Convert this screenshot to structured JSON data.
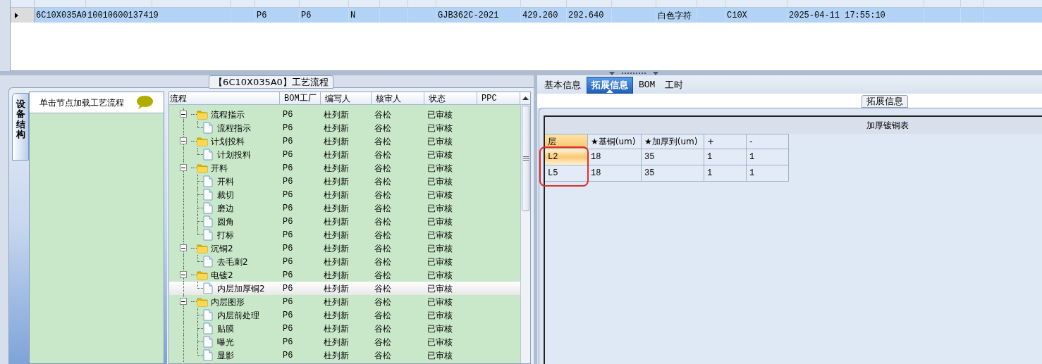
{
  "top_grid": {
    "rows": [
      {
        "selected": true,
        "column_1": "6C10X035A0",
        "column_2": "10010600137419",
        "column_5": "P6",
        "column_6": "P6",
        "column_7": "N",
        "column_10": "GJB362C-2021",
        "column_11": "429.260",
        "column_12": "292.640",
        "column_14": "白色字符",
        "column_16": "C10X",
        "column_17": "2025-04-11 17:55:10"
      }
    ]
  },
  "process_panel": {
    "title": "【6C10X035A0】工艺流程",
    "side_tab": "设备结构",
    "hint": "单击节点加载工艺流程",
    "tree": {
      "columns": [
        "流程",
        "BOM工厂",
        "编写人",
        "核审人",
        "状态",
        "PPC"
      ],
      "nodes": [
        {
          "label": "流程指示",
          "bom": "P6",
          "writer": "杜列新",
          "reviewer": "谷松",
          "status": "已审核",
          "expanded": true,
          "selected": false,
          "children": [
            {
              "label": "流程指示",
              "bom": "P6",
              "writer": "杜列新",
              "reviewer": "谷松",
              "status": "已审核",
              "selected": false
            }
          ]
        },
        {
          "label": "计划投料",
          "bom": "P6",
          "writer": "杜列新",
          "reviewer": "谷松",
          "status": "已审核",
          "expanded": true,
          "selected": false,
          "children": [
            {
              "label": "计划投料",
              "bom": "P6",
              "writer": "杜列新",
              "reviewer": "谷松",
              "status": "已审核",
              "selected": false
            }
          ]
        },
        {
          "label": "开料",
          "bom": "P6",
          "writer": "杜列新",
          "reviewer": "谷松",
          "status": "已审核",
          "expanded": true,
          "selected": false,
          "children": [
            {
              "label": "开料",
              "bom": "P6",
              "writer": "杜列新",
              "reviewer": "谷松",
              "status": "已审核",
              "selected": false
            },
            {
              "label": "裁切",
              "bom": "P6",
              "writer": "杜列新",
              "reviewer": "谷松",
              "status": "已审核",
              "selected": false
            },
            {
              "label": "磨边",
              "bom": "P6",
              "writer": "杜列新",
              "reviewer": "谷松",
              "status": "已审核",
              "selected": false
            },
            {
              "label": "圆角",
              "bom": "P6",
              "writer": "杜列新",
              "reviewer": "谷松",
              "status": "已审核",
              "selected": false
            },
            {
              "label": "打标",
              "bom": "P6",
              "writer": "杜列新",
              "reviewer": "谷松",
              "status": "已审核",
              "selected": false
            }
          ]
        },
        {
          "label": "沉铜2",
          "bom": "P6",
          "writer": "杜列新",
          "reviewer": "谷松",
          "status": "已审核",
          "expanded": true,
          "selected": false,
          "children": [
            {
              "label": "去毛刺2",
              "bom": "P6",
              "writer": "杜列新",
              "reviewer": "谷松",
              "status": "已审核",
              "selected": false
            }
          ]
        },
        {
          "label": "电镀2",
          "bom": "P6",
          "writer": "杜列新",
          "reviewer": "谷松",
          "status": "已审核",
          "expanded": true,
          "selected": false,
          "children": [
            {
              "label": "内层加厚铜2",
              "bom": "P6",
              "writer": "杜列新",
              "reviewer": "谷松",
              "status": "已审核",
              "selected": true
            }
          ]
        },
        {
          "label": "内层图形",
          "bom": "P6",
          "writer": "杜列新",
          "reviewer": "谷松",
          "status": "已审核",
          "expanded": true,
          "selected": false,
          "children": [
            {
              "label": "内层前处理",
              "bom": "P6",
              "writer": "杜列新",
              "reviewer": "谷松",
              "status": "已审核",
              "selected": false
            },
            {
              "label": "贴膜",
              "bom": "P6",
              "writer": "杜列新",
              "reviewer": "谷松",
              "status": "已审核",
              "selected": false
            },
            {
              "label": "曝光",
              "bom": "P6",
              "writer": "杜列新",
              "reviewer": "谷松",
              "status": "已审核",
              "selected": false
            },
            {
              "label": "显影",
              "bom": "P6",
              "writer": "杜列新",
              "reviewer": "谷松",
              "status": "已审核",
              "selected": false
            }
          ]
        }
      ]
    }
  },
  "detail_panel": {
    "tabs": [
      {
        "label": "基本信息",
        "selected": false
      },
      {
        "label": "拓展信息",
        "selected": true
      },
      {
        "label": "BOM",
        "selected": false
      },
      {
        "label": "工时",
        "selected": false
      }
    ],
    "group_title": "拓展信息",
    "table": {
      "title": "加厚镀铜表",
      "columns": [
        "层",
        "★基铜(um)",
        "★加厚到(um)",
        "+",
        "-"
      ],
      "rows": [
        {
          "selected": true,
          "cells": [
            "L2",
            "18",
            "35",
            "1",
            "1"
          ]
        },
        {
          "selected": false,
          "cells": [
            "L5",
            "18",
            "35",
            "1",
            "1"
          ]
        }
      ]
    }
  }
}
